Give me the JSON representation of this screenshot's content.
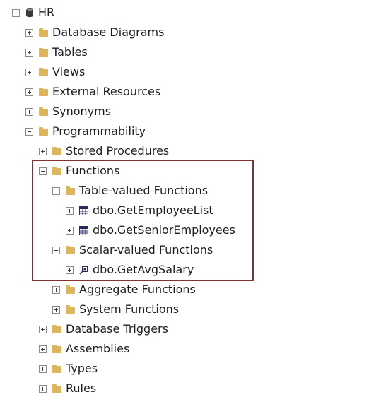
{
  "tree": {
    "root": {
      "label": "HR",
      "icon": "database-icon"
    },
    "database_diagrams": {
      "label": "Database Diagrams"
    },
    "tables": {
      "label": "Tables"
    },
    "views": {
      "label": "Views"
    },
    "external_resources": {
      "label": "External Resources"
    },
    "synonyms": {
      "label": "Synonyms"
    },
    "programmability": {
      "label": "Programmability"
    },
    "stored_procedures": {
      "label": "Stored Procedures"
    },
    "functions": {
      "label": "Functions"
    },
    "table_valued_functions": {
      "label": "Table-valued Functions"
    },
    "get_employee_list": {
      "label": "dbo.GetEmployeeList",
      "icon": "table-function-icon"
    },
    "get_senior_employees": {
      "label": "dbo.GetSeniorEmployees",
      "icon": "table-function-icon"
    },
    "scalar_valued_functions": {
      "label": "Scalar-valued Functions"
    },
    "get_avg_salary": {
      "label": "dbo.GetAvgSalary",
      "icon": "scalar-function-icon"
    },
    "aggregate_functions": {
      "label": "Aggregate Functions"
    },
    "system_functions": {
      "label": "System Functions"
    },
    "database_triggers": {
      "label": "Database Triggers"
    },
    "assemblies": {
      "label": "Assemblies"
    },
    "types": {
      "label": "Types"
    },
    "rules": {
      "label": "Rules"
    }
  },
  "colors": {
    "folder": "#dcb65d",
    "highlight_border": "#8b2f2f",
    "text": "#1e1e1e"
  }
}
